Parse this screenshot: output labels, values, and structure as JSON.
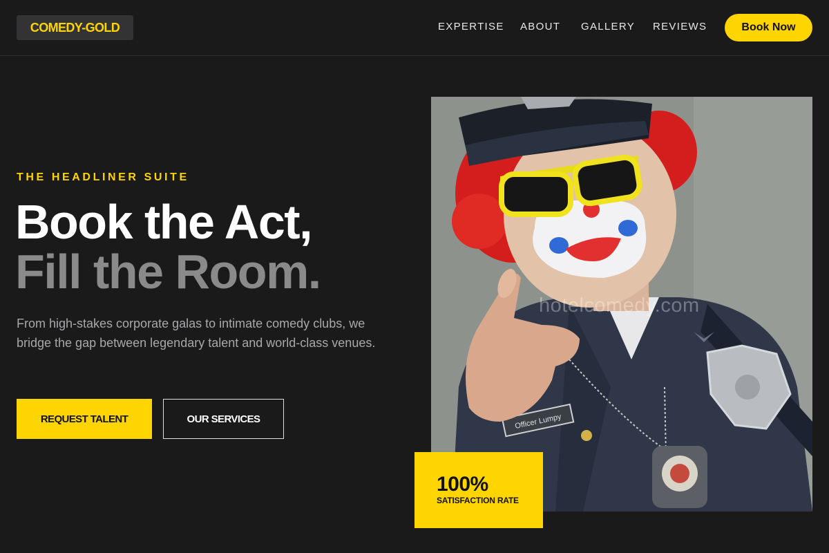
{
  "brand": {
    "logo_text": "COMEDY-GOLD"
  },
  "nav": {
    "items": [
      {
        "label": "EXPERTISE"
      },
      {
        "label": "ABOUT"
      },
      {
        "label": "GALLERY"
      },
      {
        "label": "REVIEWS"
      }
    ],
    "cta_label": "Book Now"
  },
  "hero": {
    "eyebrow": "THE HEADLINER SUITE",
    "title_line1": "Book the Act,",
    "title_line2": "Fill the Room.",
    "description": "From high-stakes corporate galas to intimate comedy clubs, we bridge the gap between legendary talent and world-class venues.",
    "primary_button": "REQUEST TALENT",
    "secondary_button": "OUR SERVICES"
  },
  "photo": {
    "watermark": "hotelcomedy.com",
    "name_tag": "Officer Lumpy"
  },
  "stat": {
    "value": "100%",
    "label": "SATISFACTION RATE"
  },
  "colors": {
    "background": "#1a1a1b",
    "accent": "#ffd500",
    "muted_title": "#8a8a8a",
    "body_text": "#a8a8ad"
  }
}
